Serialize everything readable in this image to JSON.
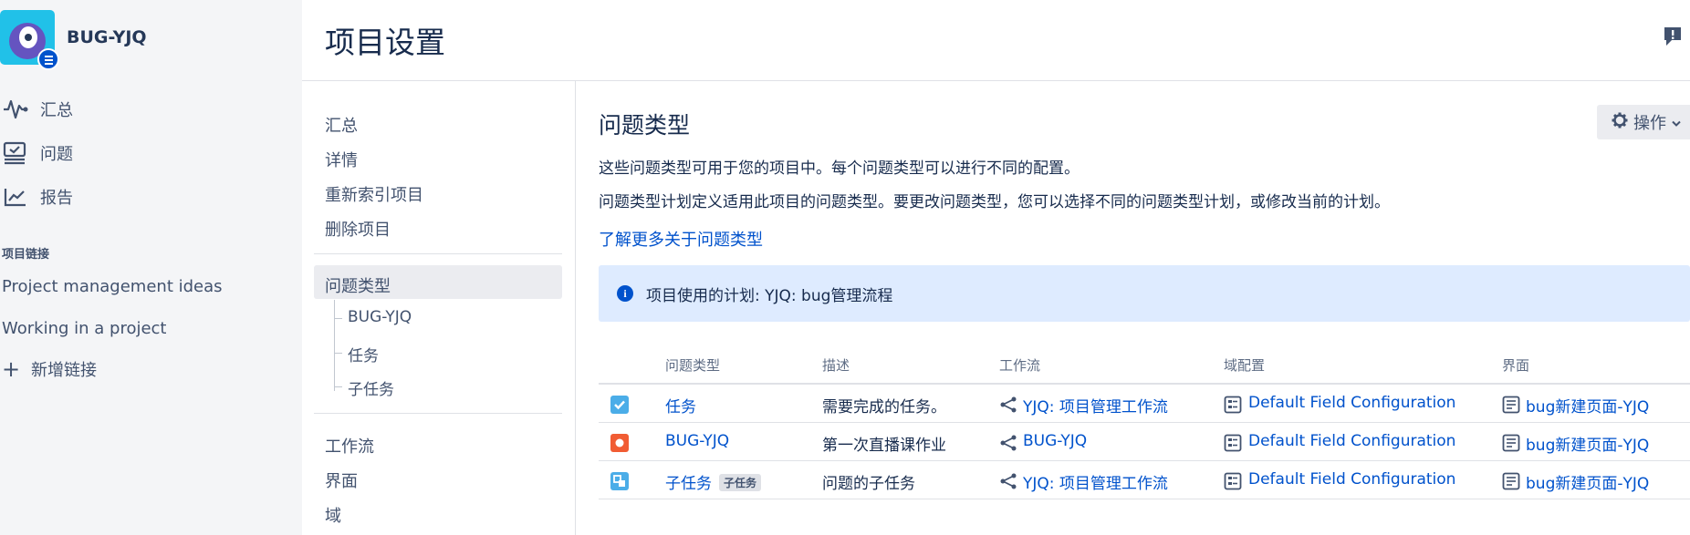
{
  "project": {
    "name": "BUG-YJQ"
  },
  "sidebar": {
    "items": [
      {
        "label": "汇总",
        "icon": "activity-icon"
      },
      {
        "label": "问题",
        "icon": "issues-icon"
      },
      {
        "label": "报告",
        "icon": "reports-icon"
      }
    ],
    "section_title": "项目链接",
    "links": [
      "Project management ideas",
      "Working in a project"
    ],
    "add_link": "新增链接"
  },
  "header": {
    "title": "项目设置"
  },
  "settings_nav": {
    "group1": [
      "汇总",
      "详情",
      "重新索引项目",
      "删除项目"
    ],
    "active": "问题类型",
    "children": [
      "BUG-YJQ",
      "任务",
      "子任务"
    ],
    "group2": [
      "工作流",
      "界面",
      "域"
    ]
  },
  "main": {
    "title": "问题类型",
    "actions_label": "操作",
    "para1": "这些问题类型可用于您的项目中。每个问题类型可以进行不同的配置。",
    "para2": "问题类型计划定义适用此项目的问题类型。要更改问题类型，您可以选择不同的问题类型计划，或修改当前的计划。",
    "learn_more": "了解更多关于问题类型",
    "info": "项目使用的计划: YJQ: bug管理流程"
  },
  "table": {
    "headers": [
      "问题类型",
      "描述",
      "工作流",
      "域配置",
      "界面"
    ],
    "rows": [
      {
        "type": "任务",
        "lozenge": "",
        "desc": "需要完成的任务。",
        "workflow": "YJQ: 项目管理工作流",
        "field_config": "Default Field Configuration",
        "screen": "bug新建页面-YJQ",
        "color": "#4bade8"
      },
      {
        "type": "BUG-YJQ",
        "lozenge": "",
        "desc": "第一次直播课作业",
        "workflow": "BUG-YJQ",
        "field_config": "Default Field Configuration",
        "screen": "bug新建页面-YJQ",
        "color": "#f15c33"
      },
      {
        "type": "子任务",
        "lozenge": "子任务",
        "desc": "问题的子任务",
        "workflow": "YJQ: 项目管理工作流",
        "field_config": "Default Field Configuration",
        "screen": "bug新建页面-YJQ",
        "color": "#4bade8"
      }
    ]
  }
}
